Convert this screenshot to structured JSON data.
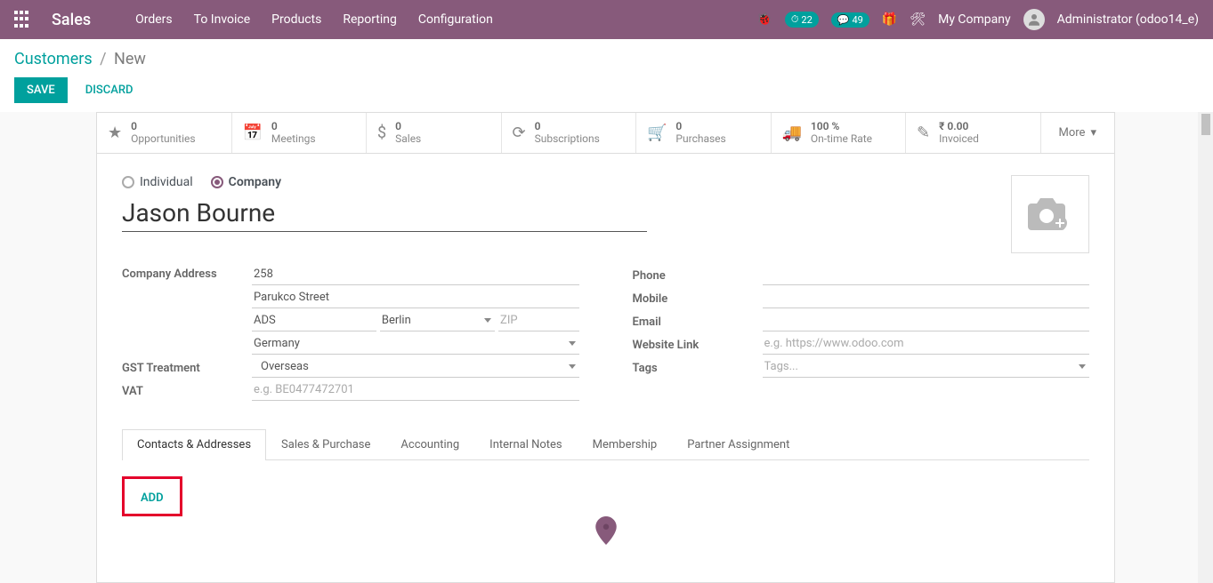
{
  "nav": {
    "brand": "Sales",
    "menu": [
      "Orders",
      "To Invoice",
      "Products",
      "Reporting",
      "Configuration"
    ],
    "badge1": "22",
    "badge2": "49",
    "company": "My Company",
    "user": "Administrator (odoo14_e)"
  },
  "breadcrumb": {
    "root": "Customers",
    "current": "New"
  },
  "actions": {
    "save": "SAVE",
    "discard": "DISCARD"
  },
  "stats": {
    "opp_val": "0",
    "opp_lbl": "Opportunities",
    "meet_val": "0",
    "meet_lbl": "Meetings",
    "sales_val": "0",
    "sales_lbl": "Sales",
    "subs_val": "0",
    "subs_lbl": "Subscriptions",
    "pur_val": "0",
    "pur_lbl": "Purchases",
    "ontime_val": "100 %",
    "ontime_lbl": "On-time Rate",
    "inv_val": "₹ 0.00",
    "inv_lbl": "Invoiced",
    "more": "More"
  },
  "radios": {
    "individual": "Individual",
    "company": "Company"
  },
  "form": {
    "name": "Jason Bourne",
    "addr_label": "Company Address",
    "street1": "258",
    "street2": "Parukco Street",
    "city": "ADS",
    "state": "Berlin",
    "zip_ph": "ZIP",
    "country": "Germany",
    "gst_label": "GST Treatment",
    "gst_val": "Overseas",
    "vat_label": "VAT",
    "vat_ph": "e.g. BE0477472701",
    "phone_label": "Phone",
    "mobile_label": "Mobile",
    "email_label": "Email",
    "web_label": "Website Link",
    "web_ph": "e.g. https://www.odoo.com",
    "tags_label": "Tags",
    "tags_ph": "Tags..."
  },
  "tabs": [
    "Contacts & Addresses",
    "Sales & Purchase",
    "Accounting",
    "Internal Notes",
    "Membership",
    "Partner Assignment"
  ],
  "add": "ADD"
}
